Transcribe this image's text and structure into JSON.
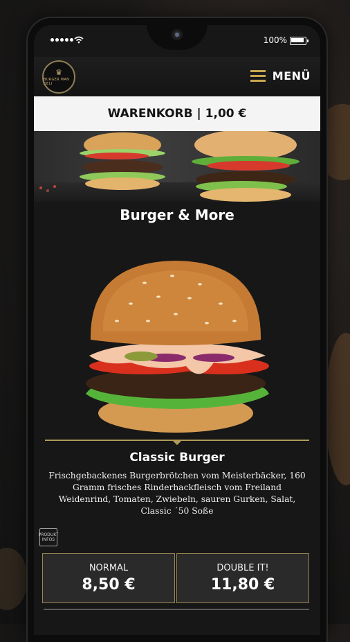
{
  "status": {
    "battery": "100%"
  },
  "header": {
    "logo_text": "BURGER MAN DELI",
    "menu_label": "MENÜ"
  },
  "cart": {
    "label": "WARENKORB | 1,00 €"
  },
  "category": {
    "title": "Burger & More"
  },
  "product": {
    "name": "Classic Burger",
    "description": "Frischgebackenes Burgerbrötchen vom Meisterbäcker, 160 Gramm frisches Rinderhackfleisch vom Freiland Weidenrind, Tomaten, Zwiebeln, sauren Gurken, Salat, Classic ´50 Soße",
    "info_icon": {
      "line1": "PRODUKT",
      "line2": "INFOS"
    }
  },
  "prices": [
    {
      "label": "NORMAL",
      "value": "8,50 €"
    },
    {
      "label": "DOUBLE IT!",
      "value": "11,80 €"
    }
  ],
  "colors": {
    "accent": "#c7a74e",
    "divider": "#b19a56"
  }
}
